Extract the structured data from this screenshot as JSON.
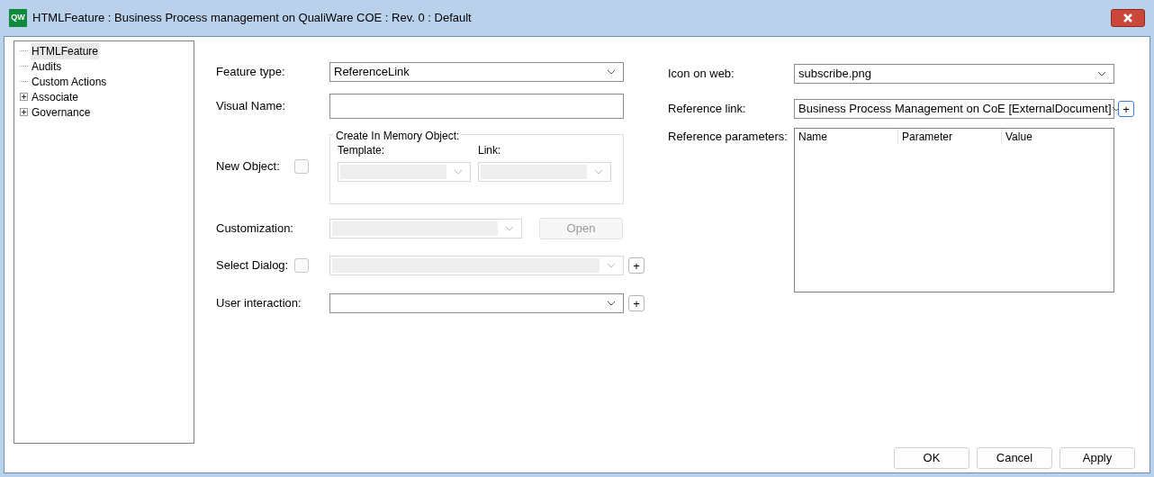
{
  "window": {
    "logo": "QW",
    "title": "HTMLFeature : Business Process management on QualiWare COE : Rev. 0  : Default"
  },
  "tree": [
    {
      "label": "HTMLFeature",
      "selected": true,
      "expandable": false
    },
    {
      "label": "Audits",
      "selected": false,
      "expandable": false
    },
    {
      "label": "Custom Actions",
      "selected": false,
      "expandable": false
    },
    {
      "label": "Associate",
      "selected": false,
      "expandable": true
    },
    {
      "label": "Governance",
      "selected": false,
      "expandable": true
    }
  ],
  "feature_type": {
    "label": "Feature type:",
    "value": "ReferenceLink"
  },
  "visual_name": {
    "label": "Visual Name:"
  },
  "new_object": {
    "label": "New Object:",
    "checked": false,
    "group_title": "Create In Memory Object:",
    "template": {
      "label": "Template:",
      "disabled": true
    },
    "link": {
      "label": "Link:",
      "disabled": true
    }
  },
  "customization": {
    "label": "Customization:",
    "disabled": true,
    "button": "Open"
  },
  "select_dialog": {
    "label": "Select Dialog:",
    "checked": false,
    "disabled": true,
    "add": "+"
  },
  "user_interaction": {
    "label": "User interaction:",
    "disabled": false,
    "add": "+"
  },
  "icon_on_web": {
    "label": "Icon on web:",
    "value": "subscribe.png"
  },
  "reference_link": {
    "label": "Reference link:",
    "value": "Business Process Management on CoE [ExternalDocument]",
    "add": "+"
  },
  "reference_parameters": {
    "label": "Reference parameters:",
    "columns": [
      "Name",
      "Parameter",
      "Value"
    ]
  },
  "buttons": [
    "OK",
    "Cancel",
    "Apply"
  ]
}
